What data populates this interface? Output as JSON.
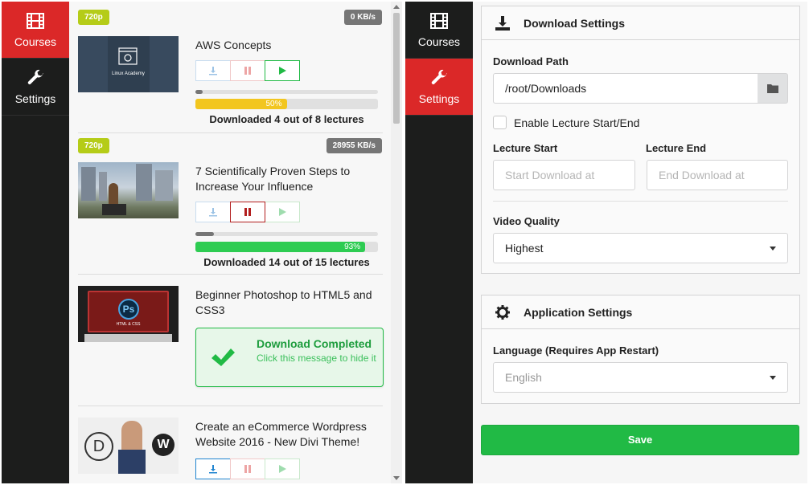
{
  "sidebar": {
    "courses_label": "Courses",
    "settings_label": "Settings",
    "accent": "#db2828"
  },
  "courses": [
    {
      "quality": "720p",
      "speed": "0 KB/s",
      "title": "AWS Concepts",
      "thumb_text": "Linux Academy",
      "progress_percent": 50,
      "progress_label": "50%",
      "lecture_progress": 0.04,
      "status": "Downloaded 4 out of 8 lectures"
    },
    {
      "quality": "720p",
      "speed": "28955 KB/s",
      "title": "7 Scientifically Proven Steps to Increase Your Influence",
      "progress_percent": 93,
      "progress_label": "93%",
      "lecture_progress": 0.1,
      "status": "Downloaded 14 out of 15 lectures"
    },
    {
      "title": "Beginner Photoshop to HTML5 and CSS3",
      "thumb_logo": "Ps",
      "thumb_text": "HTML & CSS",
      "done_title": "Download Completed",
      "done_text": "Click this message to hide it"
    },
    {
      "title": "Create an eCommerce Wordpress Website 2016 - New Divi Theme!",
      "thumb_logo": "D"
    }
  ],
  "settings": {
    "download_header": "Download Settings",
    "download_path_label": "Download Path",
    "download_path_value": "/root/Downloads",
    "enable_lecture_label": "Enable Lecture Start/End",
    "lecture_start_label": "Lecture Start",
    "lecture_start_placeholder": "Start Download at",
    "lecture_end_label": "Lecture End",
    "lecture_end_placeholder": "End Download at",
    "video_quality_label": "Video Quality",
    "video_quality_value": "Highest",
    "app_header": "Application Settings",
    "language_label": "Language (Requires App Restart)",
    "language_value": "English",
    "save_label": "Save"
  }
}
